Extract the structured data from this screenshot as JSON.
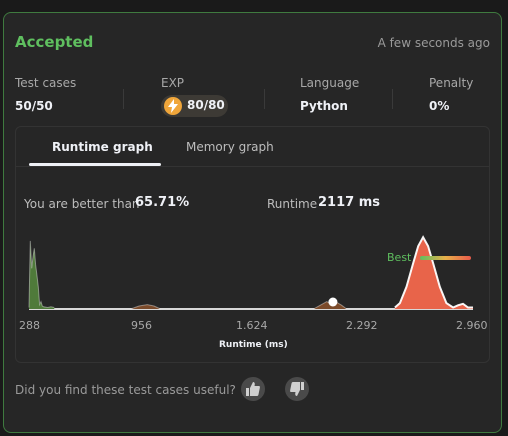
{
  "header": {
    "status": "Accepted",
    "submitted_time": "A few seconds ago"
  },
  "stats": [
    {
      "label": "Test cases",
      "value": "50/50"
    },
    {
      "label": "EXP",
      "value": "80/80",
      "icon": "lightning-bolt-icon"
    },
    {
      "label": "Language",
      "value": "Python"
    },
    {
      "label": "Penalty",
      "value": "0%"
    }
  ],
  "tabs": [
    {
      "label": "Runtime graph",
      "active": true
    },
    {
      "label": "Memory graph",
      "active": false
    }
  ],
  "summary": {
    "better_label": "You are better than",
    "better_value": "65.71%",
    "runtime_label": "Runtime",
    "runtime_value": "2117 ms"
  },
  "chart_data": {
    "type": "area",
    "xlabel": "Runtime (ms)",
    "ylabel": "",
    "x_ticks": [
      "288",
      "956",
      "1.624",
      "2.292",
      "2.960"
    ],
    "xlim": [
      288,
      2960
    ],
    "annotations": [
      "Best"
    ],
    "current_marker_x": 2117,
    "series": [
      {
        "color": "#4f7a3a",
        "x": [
          288,
          296,
          304,
          312,
          320,
          328,
          336,
          344,
          352,
          360,
          368,
          376,
          400,
          420,
          440
        ],
        "y": [
          0.02,
          0.92,
          0.55,
          0.7,
          0.82,
          0.6,
          0.45,
          0.3,
          0.06,
          0.1,
          0.04,
          0.03,
          0.02,
          0.03,
          0.02
        ]
      },
      {
        "color": "#7a4a2a",
        "x": [
          900,
          950,
          1000,
          1040,
          1080
        ],
        "y": [
          0.0,
          0.04,
          0.06,
          0.04,
          0.0
        ]
      },
      {
        "color": "#7a4a2a",
        "x": [
          2000,
          2040,
          2080,
          2110,
          2140,
          2170,
          2200
        ],
        "y": [
          0.0,
          0.05,
          0.1,
          0.06,
          0.09,
          0.05,
          0.0
        ]
      },
      {
        "color": "#e8644a",
        "x": [
          2490,
          2520,
          2560,
          2600,
          2630,
          2660,
          2690,
          2720,
          2760,
          2800,
          2840,
          2870,
          2900,
          2930,
          2960
        ],
        "y": [
          0.02,
          0.08,
          0.3,
          0.62,
          0.85,
          0.97,
          0.85,
          0.62,
          0.3,
          0.08,
          0.02,
          0.05,
          0.07,
          0.02,
          0.02
        ]
      }
    ]
  },
  "feedback": {
    "question": "Did you find these test cases useful?"
  }
}
